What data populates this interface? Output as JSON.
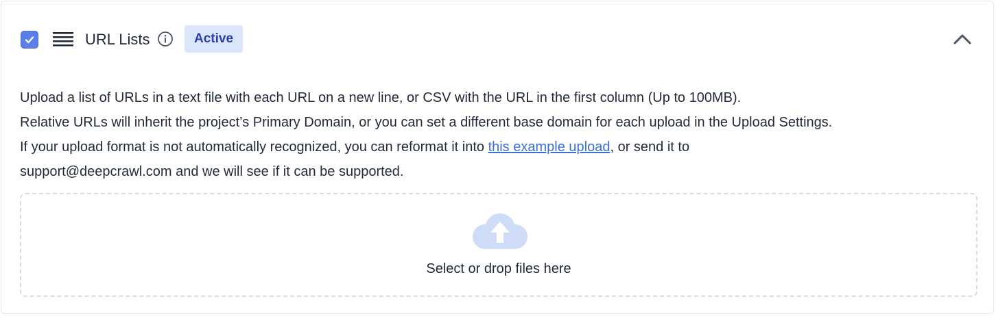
{
  "header": {
    "title": "URL Lists",
    "badge": "Active",
    "checkbox_checked": true,
    "icons": {
      "checkbox": "checkmark-icon",
      "list": "list-lines-icon",
      "info": "info-circle-icon",
      "collapse": "chevron-up-icon"
    }
  },
  "description": {
    "line1": "Upload a list of URLs in a text file with each URL on a new line, or CSV with the URL in the first column (Up to 100MB).",
    "line2": "Relative URLs will inherit the project’s Primary Domain, or you can set a different base domain for each upload in the Upload Settings.",
    "line3_before": "If your upload format is not automatically recognized, you can reformat it into ",
    "line3_link": "this example upload",
    "line3_after": ", or send it to",
    "line4": "support@deepcrawl.com and we will see if it can be supported."
  },
  "dropzone": {
    "label": "Select or drop files here",
    "icon": "cloud-upload-icon"
  },
  "colors": {
    "accent": "#5a7ee8",
    "badge_bg": "#dbe6fb",
    "badge_text": "#2a3fa8",
    "link": "#3b6fd4",
    "cloud": "#cfdcf8"
  }
}
